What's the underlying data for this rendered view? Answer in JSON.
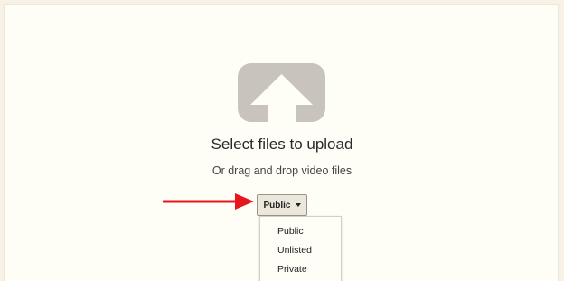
{
  "upload": {
    "icon": "upload-arrow-icon",
    "title": "Select files to upload",
    "subtitle": "Or drag and drop video files"
  },
  "privacy": {
    "selected": "Public",
    "options": [
      "Public",
      "Unlisted",
      "Private"
    ]
  },
  "annotation": {
    "icon": "red-arrow-icon",
    "color": "#e8161c"
  },
  "colors": {
    "icon_gray": "#c8c4bd",
    "background": "#fefdf6"
  }
}
